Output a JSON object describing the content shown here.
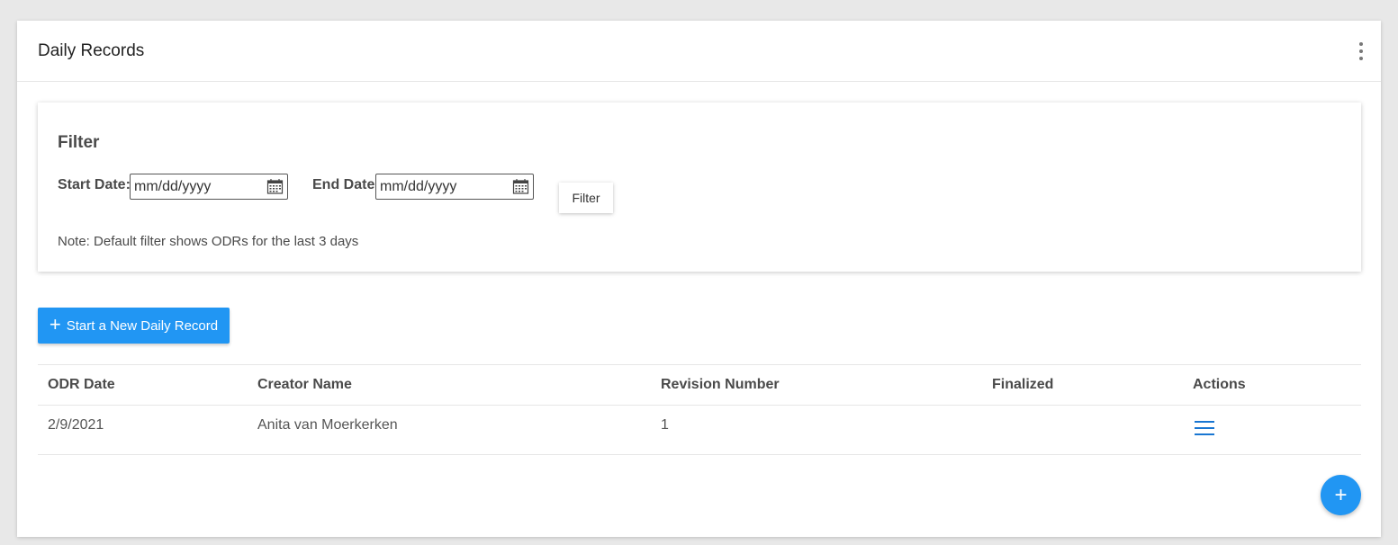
{
  "header": {
    "title": "Daily Records",
    "menu_icon": "more-vert-icon"
  },
  "filter": {
    "title": "Filter",
    "start_label": "Start Date:",
    "start_placeholder": "mm/dd/yyyy",
    "end_label": "End Date:",
    "end_placeholder": "mm/dd/yyyy",
    "button_label": "Filter",
    "note": "Note: Default filter shows ODRs for the last 3 days",
    "calendar_icon": "calendar-icon"
  },
  "actions": {
    "new_record_label": "Start a New Daily Record",
    "plus_icon": "+"
  },
  "table": {
    "columns": [
      "ODR Date",
      "Creator Name",
      "Revision Number",
      "Finalized",
      "Actions"
    ],
    "rows": [
      {
        "odr_date": "2/9/2021",
        "creator": "Anita van Moerkerken",
        "revision": "1",
        "finalized": "",
        "action_icon": "menu-icon"
      }
    ]
  },
  "fab": {
    "label": "+"
  },
  "colors": {
    "accent": "#2196f3",
    "icon_blue": "#1976d2"
  }
}
